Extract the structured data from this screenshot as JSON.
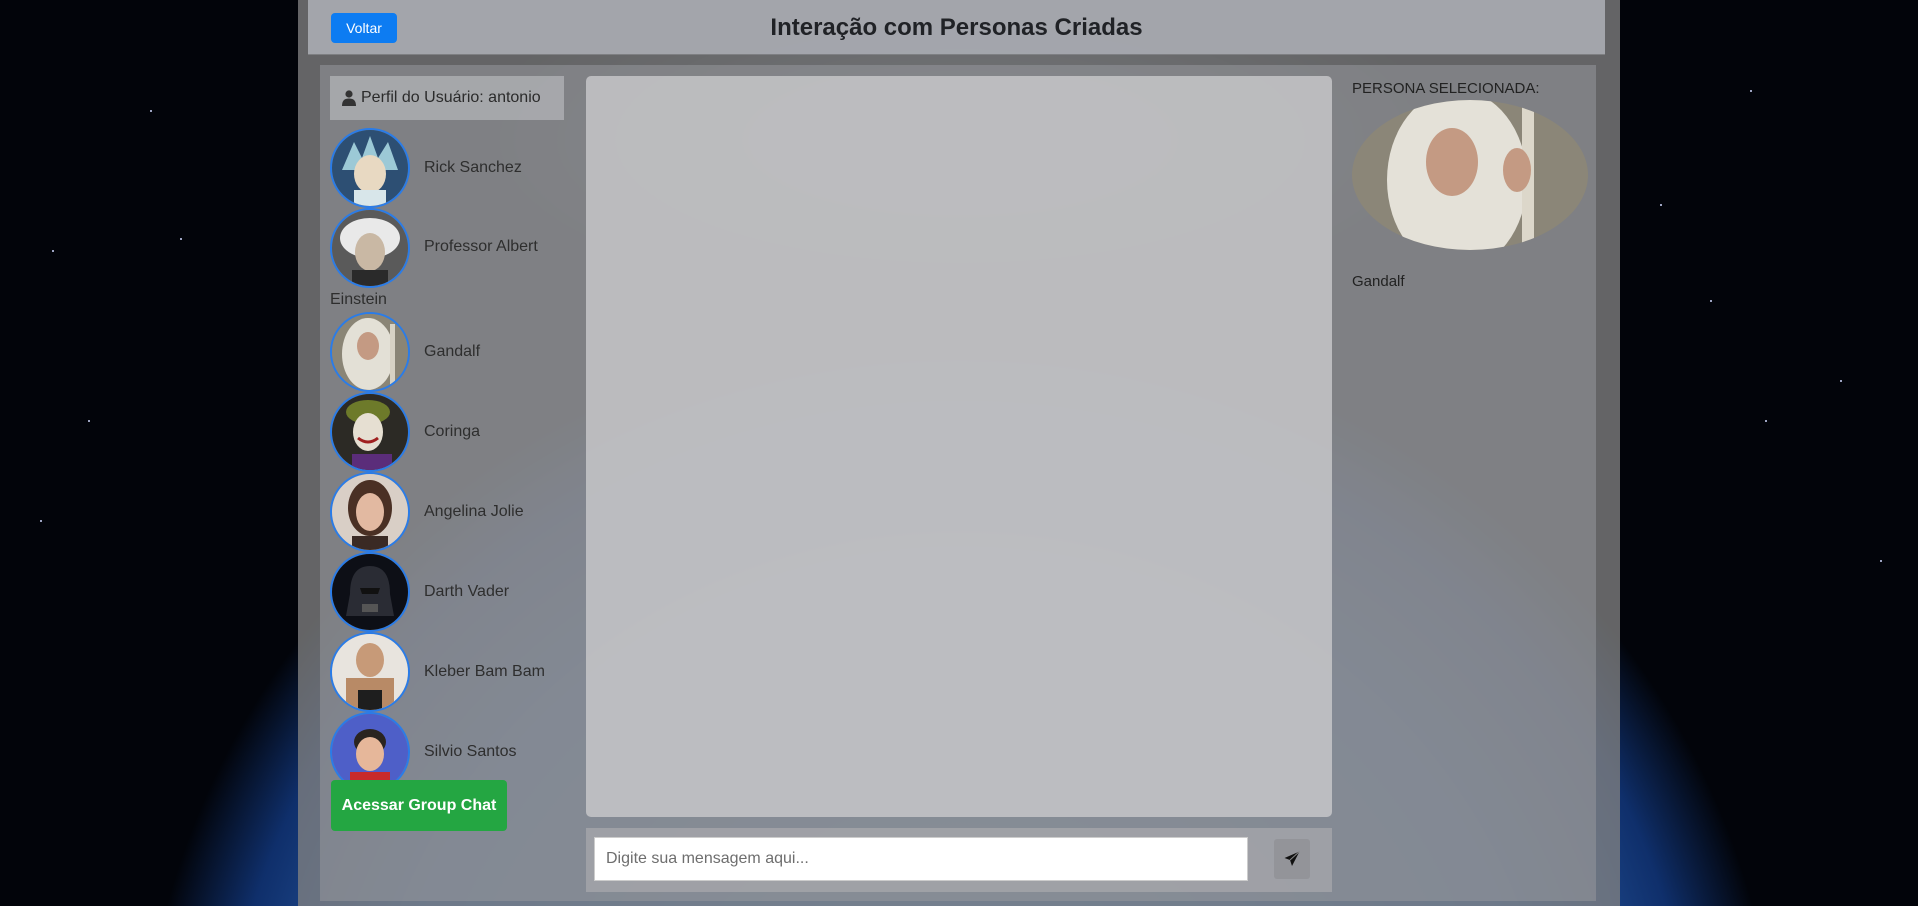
{
  "header": {
    "back_label": "Voltar",
    "title": "Interação com Personas Criadas"
  },
  "user": {
    "profile_label": "Perfil do Usuário: antonio"
  },
  "personas": [
    {
      "name": "Rick Sanchez",
      "color": "#6fa8b8"
    },
    {
      "name": "Professor Albert",
      "name_tail": "Einstein",
      "color": "#8a8a8a"
    },
    {
      "name": "Gandalf",
      "color": "#c9c2b2"
    },
    {
      "name": "Coringa",
      "color": "#4e5b3a"
    },
    {
      "name": "Angelina Jolie",
      "color": "#c59b84"
    },
    {
      "name": "Darth Vader",
      "color": "#1a1c24"
    },
    {
      "name": "Kleber Bam Bam",
      "color": "#b08a68"
    },
    {
      "name": "Silvio Santos",
      "color": "#5a62b5"
    }
  ],
  "group_chat_label": "Acessar Group Chat",
  "chat": {
    "input_placeholder": "Digite sua mensagem aqui...",
    "input_value": ""
  },
  "selected": {
    "label": "PERSONA SELECIONADA:",
    "name": "Gandalf"
  },
  "colors": {
    "primary": "#0d7cf2",
    "success": "#24a642",
    "avatar_border": "#2a7ce8"
  }
}
